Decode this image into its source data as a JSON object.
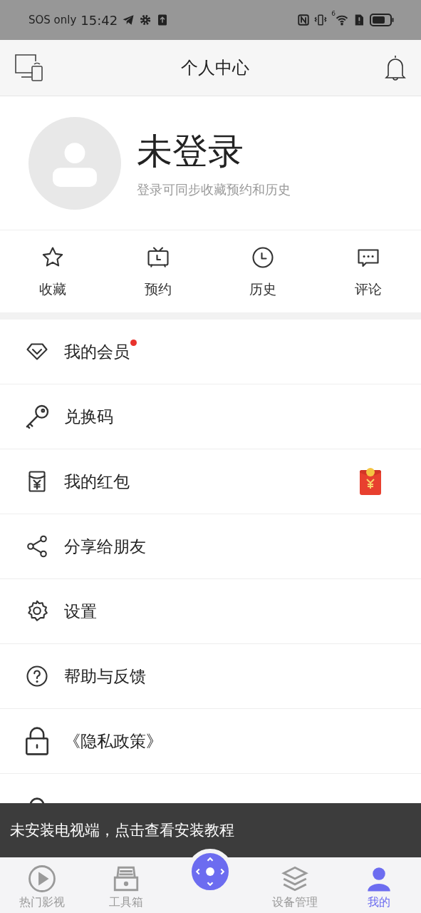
{
  "status_bar": {
    "carrier": "SOS only",
    "time": "15:42",
    "signal_label": "6"
  },
  "header": {
    "title": "个人中心"
  },
  "profile": {
    "name": "未登录",
    "subtitle": "登录可同步收藏预约和历史"
  },
  "shortcuts": [
    {
      "kind": "star",
      "label": "收藏"
    },
    {
      "kind": "tv",
      "label": "预约"
    },
    {
      "kind": "clock",
      "label": "历史"
    },
    {
      "kind": "comment",
      "label": "评论"
    }
  ],
  "menu": [
    {
      "kind": "diamond",
      "label": "我的会员",
      "dot": true,
      "envelope": false
    },
    {
      "kind": "key",
      "label": "兑换码",
      "dot": false,
      "envelope": false
    },
    {
      "kind": "redpacket",
      "label": "我的红包",
      "dot": false,
      "envelope": true
    },
    {
      "kind": "share",
      "label": "分享给朋友",
      "dot": false,
      "envelope": false
    },
    {
      "kind": "gear",
      "label": "设置",
      "dot": false,
      "envelope": false
    },
    {
      "kind": "help",
      "label": "帮助与反馈",
      "dot": false,
      "envelope": false
    },
    {
      "kind": "lock",
      "label": "《隐私政策》",
      "dot": false,
      "envelope": false
    },
    {
      "kind": "lock",
      "dot": false,
      "envelope": false
    }
  ],
  "toast": "未安装电视端，点击查看安装教程",
  "bottom_nav": [
    {
      "kind": "play",
      "label": "热门影视",
      "selected": false
    },
    {
      "kind": "toolbox",
      "label": "工具箱",
      "selected": false
    },
    {
      "kind": "remote",
      "selected": false
    },
    {
      "kind": "layers",
      "label": "设备管理",
      "selected": false
    },
    {
      "kind": "person",
      "label": "我的",
      "selected": true
    }
  ]
}
